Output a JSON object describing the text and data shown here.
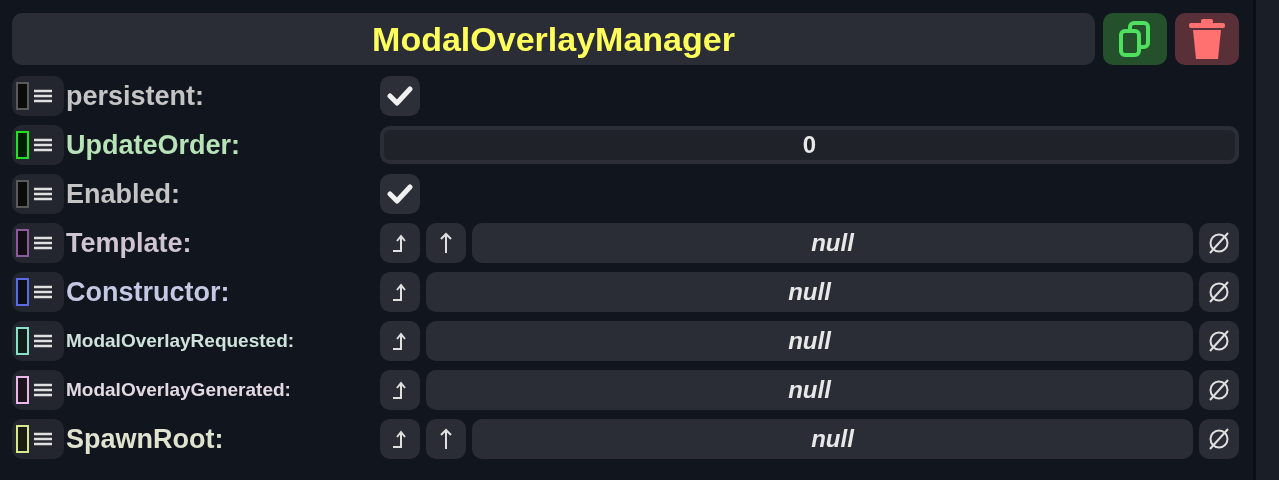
{
  "title": "ModalOverlayManager",
  "fields": [
    {
      "label": "persistent:",
      "color": "#5a5a5a",
      "kind": "checkbox",
      "checked": true
    },
    {
      "label": "UpdateOrder:",
      "color": "#22e022",
      "kind": "number",
      "value": "0"
    },
    {
      "label": "Enabled:",
      "color": "#5a5a5a",
      "kind": "checkbox",
      "checked": true
    },
    {
      "label": "Template:",
      "color": "#8a5a9a",
      "kind": "reference",
      "up_button": true,
      "value": "null"
    },
    {
      "label": "Constructor:",
      "color": "#5a6ae0",
      "kind": "reference",
      "up_button": false,
      "value": "null"
    },
    {
      "label": "ModalOverlayRequested:",
      "color": "#8ae0c8",
      "kind": "reference",
      "up_button": false,
      "value": "null"
    },
    {
      "label": "ModalOverlayGenerated:",
      "color": "#e8b8e8",
      "kind": "reference",
      "up_button": false,
      "value": "null"
    },
    {
      "label": "SpawnRoot:",
      "color": "#d8e890",
      "kind": "reference",
      "up_button": true,
      "value": "null"
    }
  ]
}
